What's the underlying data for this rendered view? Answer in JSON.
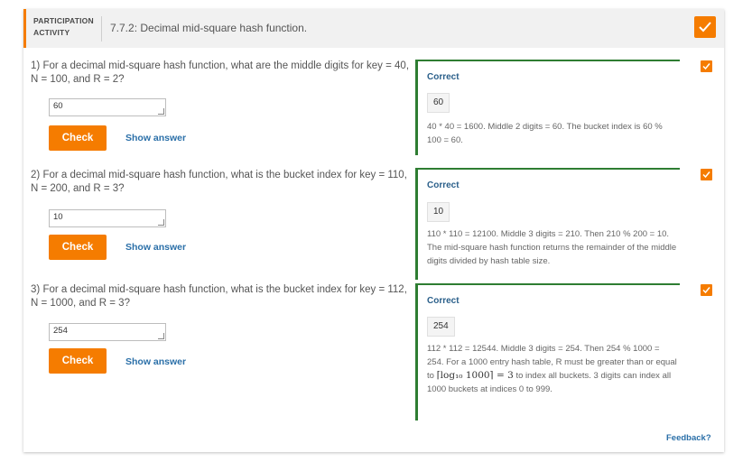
{
  "header": {
    "activity_type": "PARTICIPATION ACTIVITY",
    "title": "7.7.2: Decimal mid-square hash function."
  },
  "questions": [
    {
      "number": "1)",
      "text": "For a decimal mid-square hash function, what are the middle digits for key = 40, N = 100, and R = 2?",
      "answer": "60",
      "status": "Correct",
      "correct_value": "60",
      "explanation": "40 * 40 = 1600. Middle 2 digits = 60. The bucket index is 60 % 100 = 60."
    },
    {
      "number": "2)",
      "text": "For a decimal mid-square hash function, what is the bucket index for key = 110, N = 200, and R = 3?",
      "answer": "10",
      "status": "Correct",
      "correct_value": "10",
      "explanation": "110 * 110 = 12100. Middle 3 digits = 210. Then 210 % 200 = 10. The mid-square hash function returns the remainder of the middle digits divided by hash table size."
    },
    {
      "number": "3)",
      "text": "For a decimal mid-square hash function, what is the bucket index for key = 112, N = 1000, and R = 3?",
      "answer": "254",
      "status": "Correct",
      "correct_value": "254",
      "explanation_pre": "112 * 112 = 12544. Middle 3 digits = 254. Then 254 % 1000 = 254. For a 1000 entry hash table, R must be greater than or equal to",
      "explanation_math": "⌈log₁₀ 1000⌉ = 3",
      "explanation_post": "to index all buckets. 3 digits can index all 1000 buckets at indices 0 to 999."
    }
  ],
  "buttons": {
    "check": "Check",
    "show_answer": "Show answer"
  },
  "feedback_link": "Feedback?",
  "colors": {
    "accent": "#f57c00",
    "correct": "#2e7d32",
    "link": "#2a6fa8"
  },
  "icons": {
    "complete": "check-icon"
  }
}
